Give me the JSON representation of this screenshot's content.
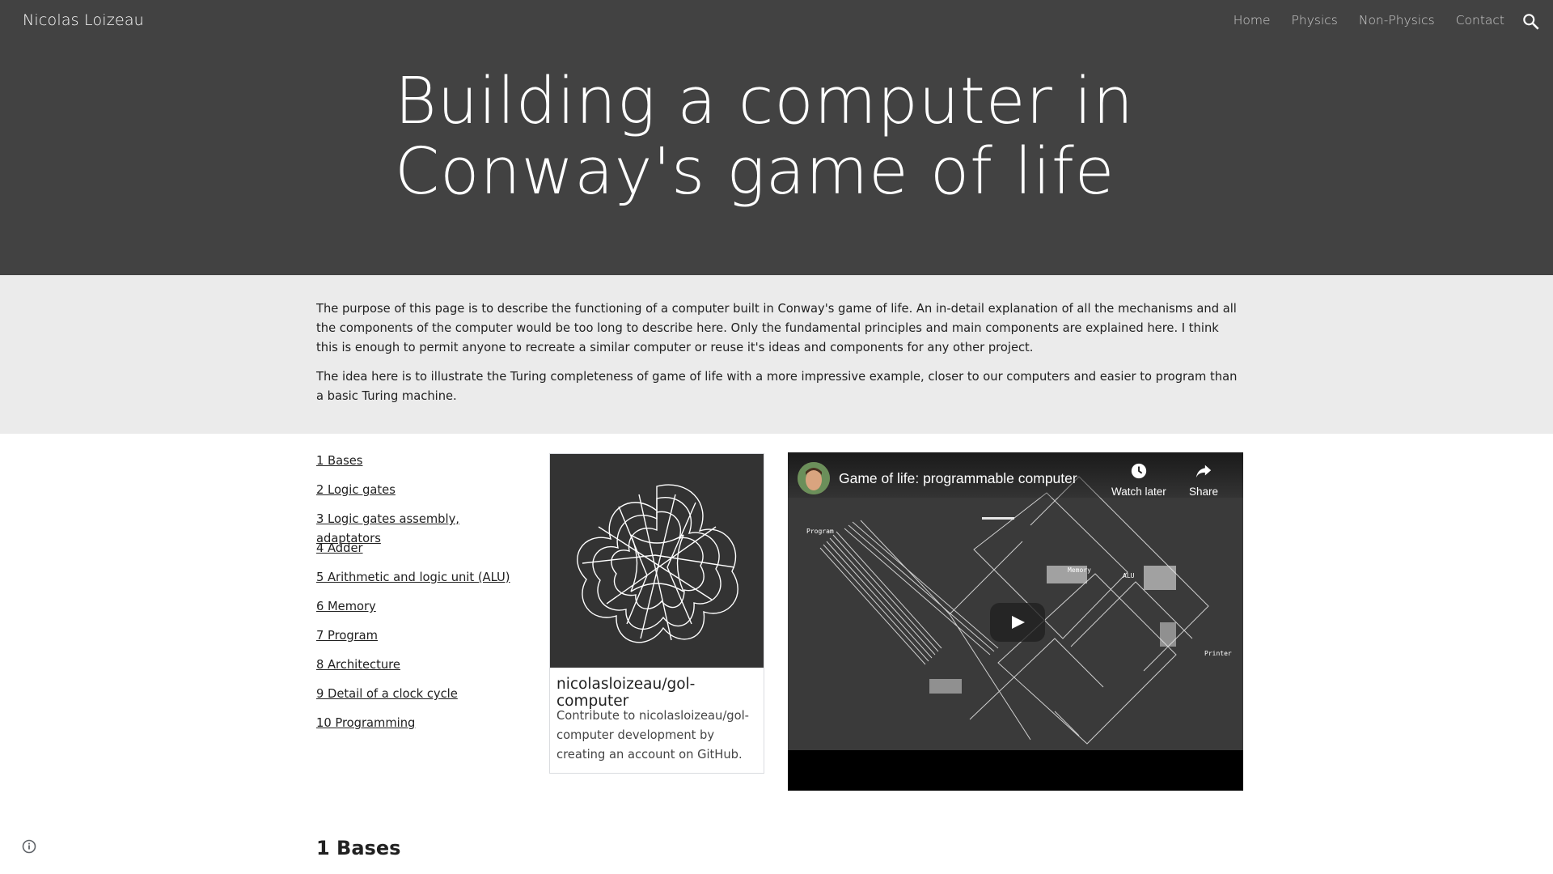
{
  "site": {
    "title": "Nicolas Loizeau"
  },
  "nav": {
    "items": [
      "Home",
      "Physics",
      "Non-Physics",
      "Contact"
    ]
  },
  "hero": {
    "title_line1": "Building a computer in",
    "title_line2": "Conway's game of life"
  },
  "intro": {
    "p1": "The purpose of this page is to describe the functioning of a computer built in Conway's game of life. An in-detail explanation of all the mechanisms and all the components of the computer would be too long to describe here. Only the fundamental principles and main components are explained here. I think this is enough to permit anyone to recreate a similar computer or reuse it's ideas and components for any other project.",
    "p2": "The idea here is to illustrate the Turing completeness of game of life with a more impressive example, closer to our computers and easier to program than a basic Turing machine."
  },
  "toc": [
    "1 Bases",
    "2 Logic gates",
    "3 Logic gates assembly, adaptators",
    "4 Adder",
    "5 Arithmetic and logic unit (ALU)",
    "6 Memory",
    "7 Program",
    "8 Architecture",
    "9 Detail of a clock cycle",
    "10 Programming"
  ],
  "card": {
    "title": "nicolasloizeau/gol-computer",
    "description": "Contribute to nicolasloizeau/gol-computer development by creating an account on GitHub."
  },
  "video": {
    "title": "Game of life: programmable computer",
    "watch_later": "Watch later",
    "share": "Share",
    "labels": {
      "program": "Program",
      "memory": "Memory",
      "alu": "ALU",
      "printer": "Printer"
    }
  },
  "section": {
    "heading": "1 Bases"
  },
  "colors": {
    "header_bg": "#424242",
    "intro_bg": "#ebebeb",
    "text": "#212121"
  },
  "icons": {
    "search": "search-icon",
    "info": "info-icon",
    "play": "play-icon",
    "clock": "clock-icon",
    "share": "share-icon"
  }
}
